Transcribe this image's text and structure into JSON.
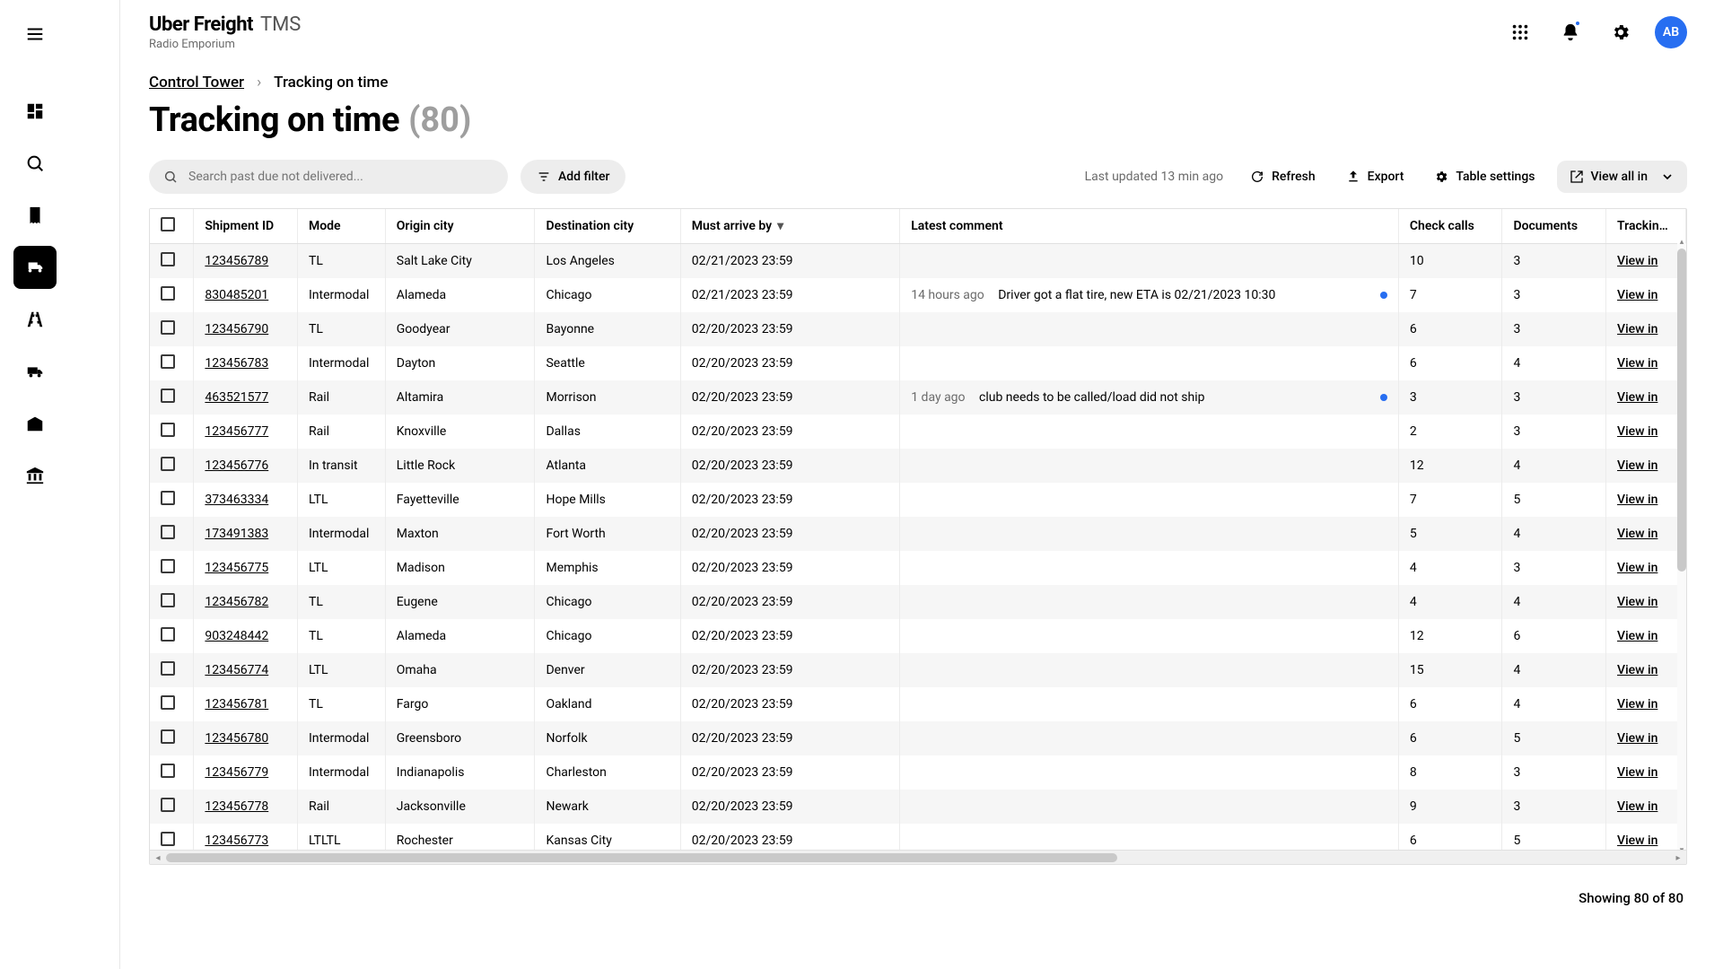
{
  "brand": {
    "name": "Uber Freight",
    "product": "TMS",
    "subtitle": "Radio Emporium"
  },
  "header": {
    "avatar_initials": "AB"
  },
  "breadcrumbs": {
    "root": "Control Tower",
    "current": "Tracking on time"
  },
  "page": {
    "title": "Tracking on time",
    "count_display": "(80)"
  },
  "search": {
    "placeholder": "Search past due not delivered..."
  },
  "toolbar": {
    "add_filter": "Add filter",
    "last_updated": "Last updated 13 min ago",
    "refresh": "Refresh",
    "export": "Export",
    "table_settings": "Table settings",
    "view_all": "View all in"
  },
  "columns": {
    "shipment_id": "Shipment ID",
    "mode": "Mode",
    "origin": "Origin city",
    "destination": "Destination city",
    "must_arrive": "Must arrive by",
    "latest_comment": "Latest comment",
    "check_calls": "Check calls",
    "documents": "Documents",
    "tracking_d": "Tracking d"
  },
  "view_in_label": "View in",
  "rows": [
    {
      "id": "123456789",
      "mode": "TL",
      "origin": "Salt Lake City",
      "dest": "Los Angeles",
      "arrive": "02/21/2023 23:59",
      "comment_age": "",
      "comment": "",
      "dot": false,
      "calls": "10",
      "docs": "3"
    },
    {
      "id": "830485201",
      "mode": "Intermodal",
      "origin": "Alameda",
      "dest": "Chicago",
      "arrive": "02/21/2023 23:59",
      "comment_age": "14 hours ago",
      "comment": "Driver got a flat tire, new ETA is 02/21/2023 10:30",
      "dot": true,
      "calls": "7",
      "docs": "3"
    },
    {
      "id": "123456790",
      "mode": "TL",
      "origin": "Goodyear",
      "dest": "Bayonne",
      "arrive": "02/20/2023 23:59",
      "comment_age": "",
      "comment": "",
      "dot": false,
      "calls": "6",
      "docs": "3"
    },
    {
      "id": "123456783",
      "mode": "Intermodal",
      "origin": "Dayton",
      "dest": "Seattle",
      "arrive": "02/20/2023 23:59",
      "comment_age": "",
      "comment": "",
      "dot": false,
      "calls": "6",
      "docs": "4"
    },
    {
      "id": "463521577",
      "mode": "Rail",
      "origin": "Altamira",
      "dest": "Morrison",
      "arrive": "02/20/2023 23:59",
      "comment_age": "1 day ago",
      "comment": "club needs to be called/load did not ship",
      "dot": true,
      "calls": "3",
      "docs": "3"
    },
    {
      "id": "123456777",
      "mode": "Rail",
      "origin": "Knoxville",
      "dest": "Dallas",
      "arrive": "02/20/2023 23:59",
      "comment_age": "",
      "comment": "",
      "dot": false,
      "calls": "2",
      "docs": "3"
    },
    {
      "id": "123456776",
      "mode": "In transit",
      "origin": "Little Rock",
      "dest": "Atlanta",
      "arrive": "02/20/2023 23:59",
      "comment_age": "",
      "comment": "",
      "dot": false,
      "calls": "12",
      "docs": "4"
    },
    {
      "id": "373463334",
      "mode": "LTL",
      "origin": "Fayetteville",
      "dest": "Hope Mills",
      "arrive": "02/20/2023 23:59",
      "comment_age": "",
      "comment": "",
      "dot": false,
      "calls": "7",
      "docs": "5"
    },
    {
      "id": "173491383",
      "mode": "Intermodal",
      "origin": "Maxton",
      "dest": "Fort Worth",
      "arrive": "02/20/2023 23:59",
      "comment_age": "",
      "comment": "",
      "dot": false,
      "calls": "5",
      "docs": "4"
    },
    {
      "id": "123456775",
      "mode": "LTL",
      "origin": "Madison",
      "dest": "Memphis",
      "arrive": "02/20/2023 23:59",
      "comment_age": "",
      "comment": "",
      "dot": false,
      "calls": "4",
      "docs": "3"
    },
    {
      "id": "123456782",
      "mode": "TL",
      "origin": "Eugene",
      "dest": "Chicago",
      "arrive": "02/20/2023 23:59",
      "comment_age": "",
      "comment": "",
      "dot": false,
      "calls": "4",
      "docs": "4"
    },
    {
      "id": "903248442",
      "mode": "TL",
      "origin": "Alameda",
      "dest": "Chicago",
      "arrive": "02/20/2023 23:59",
      "comment_age": "",
      "comment": "",
      "dot": false,
      "calls": "12",
      "docs": "6"
    },
    {
      "id": "123456774",
      "mode": "LTL",
      "origin": "Omaha",
      "dest": "Denver",
      "arrive": "02/20/2023 23:59",
      "comment_age": "",
      "comment": "",
      "dot": false,
      "calls": "15",
      "docs": "4"
    },
    {
      "id": "123456781",
      "mode": "TL",
      "origin": "Fargo",
      "dest": "Oakland",
      "arrive": "02/20/2023 23:59",
      "comment_age": "",
      "comment": "",
      "dot": false,
      "calls": "6",
      "docs": "4"
    },
    {
      "id": "123456780",
      "mode": "Intermodal",
      "origin": "Greensboro",
      "dest": "Norfolk",
      "arrive": "02/20/2023 23:59",
      "comment_age": "",
      "comment": "",
      "dot": false,
      "calls": "6",
      "docs": "5"
    },
    {
      "id": "123456779",
      "mode": "Intermodal",
      "origin": "Indianapolis",
      "dest": "Charleston",
      "arrive": "02/20/2023 23:59",
      "comment_age": "",
      "comment": "",
      "dot": false,
      "calls": "8",
      "docs": "3"
    },
    {
      "id": "123456778",
      "mode": "Rail",
      "origin": "Jacksonville",
      "dest": "Newark",
      "arrive": "02/20/2023 23:59",
      "comment_age": "",
      "comment": "",
      "dot": false,
      "calls": "9",
      "docs": "3"
    },
    {
      "id": "123456773",
      "mode": "LTLTL",
      "origin": "Rochester",
      "dest": "Kansas City",
      "arrive": "02/20/2023 23:59",
      "comment_age": "",
      "comment": "",
      "dot": false,
      "calls": "6",
      "docs": "5"
    }
  ],
  "footer": {
    "showing": "Showing 80 of 80"
  }
}
